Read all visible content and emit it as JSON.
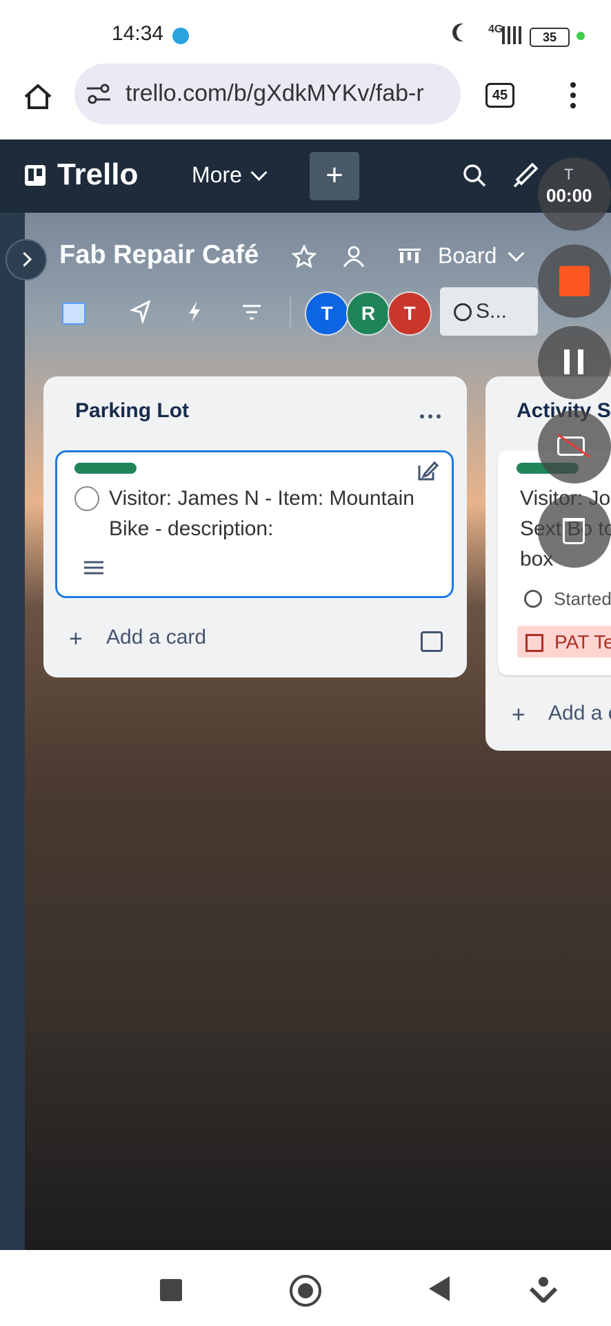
{
  "status": {
    "time": "14:34",
    "signal": "4G",
    "battery": "35"
  },
  "browser": {
    "url": "trello.com/b/gXdkMYKv/fab-r",
    "tab_count": "45"
  },
  "trello": {
    "logo": "Trello",
    "more_label": "More",
    "board_title": "Fab Repair Café",
    "view_label": "Board",
    "share_label": "S...",
    "members": [
      {
        "initial": "T",
        "color": "#0c66e4"
      },
      {
        "initial": "R",
        "color": "#1f845a"
      },
      {
        "initial": "T",
        "color": "#c9372c"
      }
    ]
  },
  "lists": [
    {
      "title": "Parking Lot",
      "cards": [
        {
          "text": "Visitor: James N - Item: Mountain Bike - description:"
        }
      ],
      "add_label": "Add a card"
    },
    {
      "title": "Activity St",
      "cards": [
        {
          "text": "Visitor: Jo Sext Bo to box",
          "started": "Started",
          "badge": "PAT Te"
        }
      ],
      "add_label": "Add a c"
    }
  ],
  "recorder": {
    "timer": "00:00",
    "avatar_initial": "T"
  },
  "colors": {
    "header": "#1d2b3a",
    "accent": "#1f7ae0",
    "label_green": "#1f845a",
    "record": "#ff5722"
  }
}
